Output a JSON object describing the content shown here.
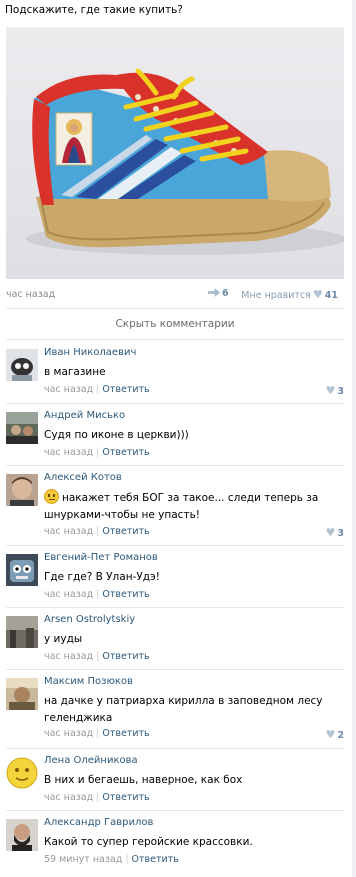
{
  "post": {
    "text": "Подскажите, где такие купить?",
    "photo_icon": "sneaker-photo",
    "time": "час назад",
    "reposts": "6",
    "likes_label": "Мне нравится",
    "likes_count": "41"
  },
  "hide_comments": "Скрыть комментарии",
  "comments": [
    {
      "author": "Иван Николаевич",
      "text": "в магазине",
      "time": "час назад",
      "reply": "Ответить",
      "likes": "3"
    },
    {
      "author": "Андрей Мисько",
      "text": "Судя по иконе в церкви)))",
      "time": "час назад",
      "reply": "Ответить",
      "likes": ""
    },
    {
      "author": "Алексей Котов",
      "text": "накажет тебя БОГ за такое... следи теперь за шнурками-чтобы не упасть!",
      "time": "час назад",
      "reply": "Ответить",
      "likes": "3"
    },
    {
      "author": "Евгений-Пет Романов",
      "text": "Где где? В Улан-Удэ!",
      "time": "час назад",
      "reply": "Ответить",
      "likes": ""
    },
    {
      "author": "Arsen Ostrolytskiy",
      "text": "у иуды",
      "time": "час назад",
      "reply": "Ответить",
      "likes": ""
    },
    {
      "author": "Максим Позюков",
      "text": "на дачке у патриарха кирилла в заповедном лесу геленджика",
      "time": "час назад",
      "reply": "Ответить",
      "likes": "2"
    },
    {
      "author": "Лена Олейникова",
      "text": "В них и бегаешь, наверное, как бох",
      "time": "час назад",
      "reply": "Ответить",
      "likes": ""
    },
    {
      "author": "Александр Гаврилов",
      "text": "Какой то супер геройские крассовки.",
      "time": "59 минут назад",
      "reply": "Ответить",
      "likes": ""
    }
  ]
}
